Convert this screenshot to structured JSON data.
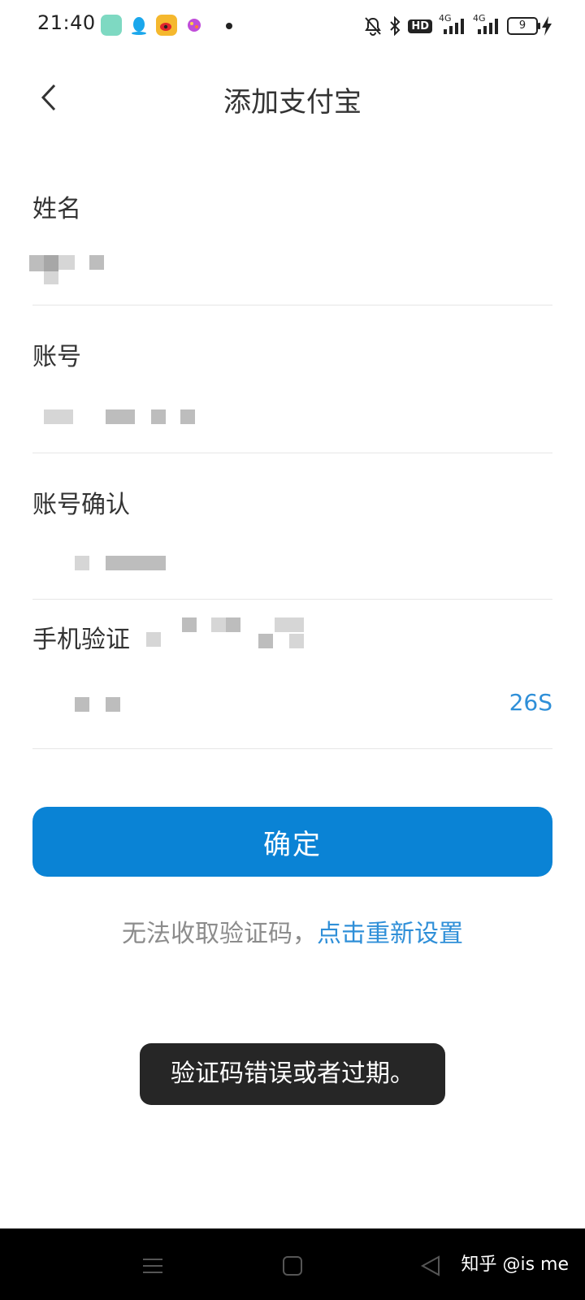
{
  "status_bar": {
    "time": "21:40",
    "app_icons": [
      "app-icon",
      "qq-icon",
      "weibo-icon",
      "game-icon"
    ],
    "right_icons": [
      "bell-off-icon",
      "bluetooth-icon",
      "hd-icon",
      "signal-4g-icon",
      "signal-4g-icon"
    ],
    "hd_label": "HD",
    "net_label_1": "4G",
    "net_label_2": "4G",
    "battery_level": "9"
  },
  "header": {
    "title": "添加支付宝",
    "back_icon": "chevron-left-icon"
  },
  "form": {
    "name_label": "姓名",
    "account_label": "账号",
    "account_confirm_label": "账号确认",
    "phone_verify_label": "手机验证",
    "countdown": "26S"
  },
  "confirm_button": "确定",
  "hint": {
    "text": "无法收取验证码，",
    "link": "点击重新设置"
  },
  "toast": "验证码错误或者过期。",
  "nav_bar": {
    "icons": [
      "menu-icon",
      "home-square-icon",
      "back-triangle-icon"
    ],
    "watermark": "知乎 @is me"
  },
  "colors": {
    "accent": "#0a83d5",
    "link": "#2f8fd8",
    "toast_bg": "#262626"
  }
}
